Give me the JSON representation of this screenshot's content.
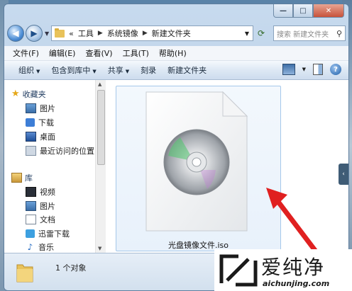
{
  "window": {
    "caption": {
      "minimize": "—",
      "maximize": "□",
      "close": "✕"
    }
  },
  "address": {
    "prefix": "«",
    "crumbs": [
      "工具",
      "系统镜像",
      "新建文件夹"
    ],
    "search_placeholder": "搜索 新建文件夹"
  },
  "menu": [
    "文件(F)",
    "编辑(E)",
    "查看(V)",
    "工具(T)",
    "帮助(H)"
  ],
  "toolbar": {
    "commands": [
      {
        "label": "组织",
        "dropdown": true
      },
      {
        "label": "包含到库中",
        "dropdown": true
      },
      {
        "label": "共享",
        "dropdown": true
      },
      {
        "label": "刻录",
        "dropdown": false
      },
      {
        "label": "新建文件夹",
        "dropdown": false
      }
    ],
    "help": "?"
  },
  "nav": {
    "favorites_label": "收藏夹",
    "favorites": [
      {
        "label": "图片",
        "icon": "pictures-icon"
      },
      {
        "label": "下载",
        "icon": "download-icon"
      },
      {
        "label": "桌面",
        "icon": "desktop-icon"
      },
      {
        "label": "最近访问的位置",
        "icon": "recent-places-icon"
      }
    ],
    "library_label": "库",
    "library": [
      {
        "label": "视频",
        "icon": "video-icon"
      },
      {
        "label": "图片",
        "icon": "pictures-icon"
      },
      {
        "label": "文档",
        "icon": "document-icon"
      },
      {
        "label": "迅雷下载",
        "icon": "xunlei-icon"
      },
      {
        "label": "音乐",
        "icon": "music-icon"
      }
    ]
  },
  "files": [
    {
      "name": "光盘镜像文件.iso",
      "icon": "iso-disc-icon",
      "selected": true
    }
  ],
  "status": {
    "count_text": "1 个对象"
  },
  "watermark": {
    "brand": "爱纯净",
    "url": "aichunjing.com"
  },
  "colors": {
    "arrow": "#e02020",
    "selection_border": "#a6c8ea"
  }
}
